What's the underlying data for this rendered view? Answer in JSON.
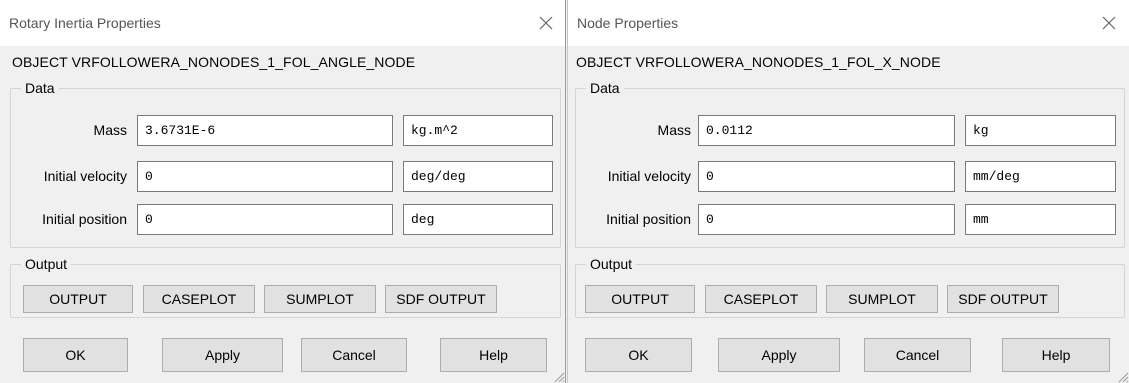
{
  "dialogs": [
    {
      "title": "Rotary Inertia Properties",
      "object_line": "OBJECT  VRFOLLOWERA_NONODES_1_FOL_ANGLE_NODE",
      "data_group": "Data",
      "fields": [
        {
          "label": "Mass",
          "value": "3.6731E-6",
          "unit": "kg.m^2"
        },
        {
          "label": "Initial velocity",
          "value": "0",
          "unit": "deg/deg"
        },
        {
          "label": "Initial position",
          "value": "0",
          "unit": "deg"
        }
      ],
      "output_group": "Output",
      "output_buttons": [
        "OUTPUT",
        "CASEPLOT",
        "SUMPLOT",
        "SDF OUTPUT"
      ],
      "actions": {
        "ok": "OK",
        "apply": "Apply",
        "cancel": "Cancel",
        "help": "Help"
      }
    },
    {
      "title": "Node Properties",
      "object_line": "OBJECT  VRFOLLOWERA_NONODES_1_FOL_X_NODE",
      "data_group": "Data",
      "fields": [
        {
          "label": "Mass",
          "value": "0.0112",
          "unit": "kg"
        },
        {
          "label": "Initial velocity",
          "value": "0",
          "unit": "mm/deg"
        },
        {
          "label": "Initial position",
          "value": "0",
          "unit": "mm"
        }
      ],
      "output_group": "Output",
      "output_buttons": [
        "OUTPUT",
        "CASEPLOT",
        "SUMPLOT",
        "SDF OUTPUT"
      ],
      "actions": {
        "ok": "OK",
        "apply": "Apply",
        "cancel": "Cancel",
        "help": "Help"
      }
    }
  ],
  "icons": {
    "close": "close-icon",
    "resize": "resize-grip-icon"
  }
}
